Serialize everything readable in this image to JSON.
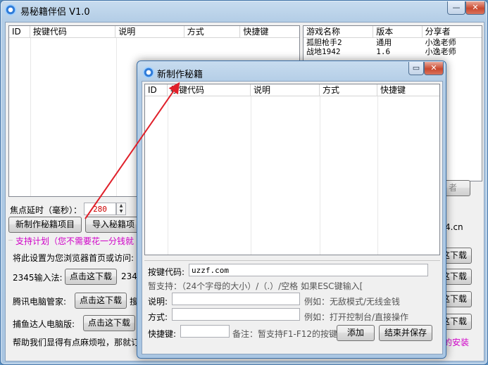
{
  "main": {
    "title": "易秘籍伴侣 V1.0",
    "minimize_glyph": "—",
    "close_glyph": "✕",
    "left_list": {
      "columns": [
        "ID",
        "按键代码",
        "说明",
        "方式",
        "快捷键"
      ]
    },
    "right_list": {
      "columns": [
        "游戏名称",
        "版本",
        "分享者"
      ],
      "rows": [
        [
          "孤胆枪手2",
          "通用",
          "小逸老师"
        ],
        [
          "战地1942",
          "1.6",
          "小逸老师"
        ]
      ],
      "right_button_partial": "者"
    },
    "focus_delay_label": "焦点延时（毫秒）：",
    "focus_delay_value": "280",
    "create_button": "新制作秘籍项目",
    "import_button": "导入秘籍项",
    "support_plan": "支持计划（您不需要花一分钱就",
    "homepage_text": "将此设置为您浏览器首页或访问:",
    "site_partial": "4.cn",
    "input2345_label": "2345输入法:",
    "download_label": "点击这下载",
    "input2345_trailing": "2345",
    "tencent_label": "腾讯电脑管家:",
    "tencent_trailing": "搜",
    "fishing_label": "捕鱼达人电脑版:",
    "footer_text": "帮助我们显得有点麻烦啦，那就订",
    "footer_right": "的安装",
    "right_download_partial": "这下载"
  },
  "dialog": {
    "title": "新制作秘籍",
    "maximize_glyph": "▭",
    "close_glyph": "✕",
    "list": {
      "columns": [
        "ID",
        "按键代码",
        "说明",
        "方式",
        "快捷键"
      ]
    },
    "code_label": "按键代码:",
    "code_value": "uzzf.com",
    "support_text": "暂支持：（24个字母的大小）/（.）/空格   如果ESC键输入[",
    "desc_label": "说明:",
    "desc_value": "",
    "desc_example": "例如：无敌模式/无线金钱",
    "mode_label": "方式:",
    "mode_value": "",
    "mode_example": "例如：打开控制台/直接操作",
    "hotkey_label": "快捷键:",
    "hotkey_value": "",
    "hotkey_note": "备注：暂支持F1-F12的按键",
    "add_button": "添加",
    "save_button": "结束并保存"
  },
  "colors": {
    "arrow": "#e0202a",
    "magenta_text": "#d000c8",
    "delay_value": "#c00000",
    "window_border": "#3b6fa6"
  }
}
